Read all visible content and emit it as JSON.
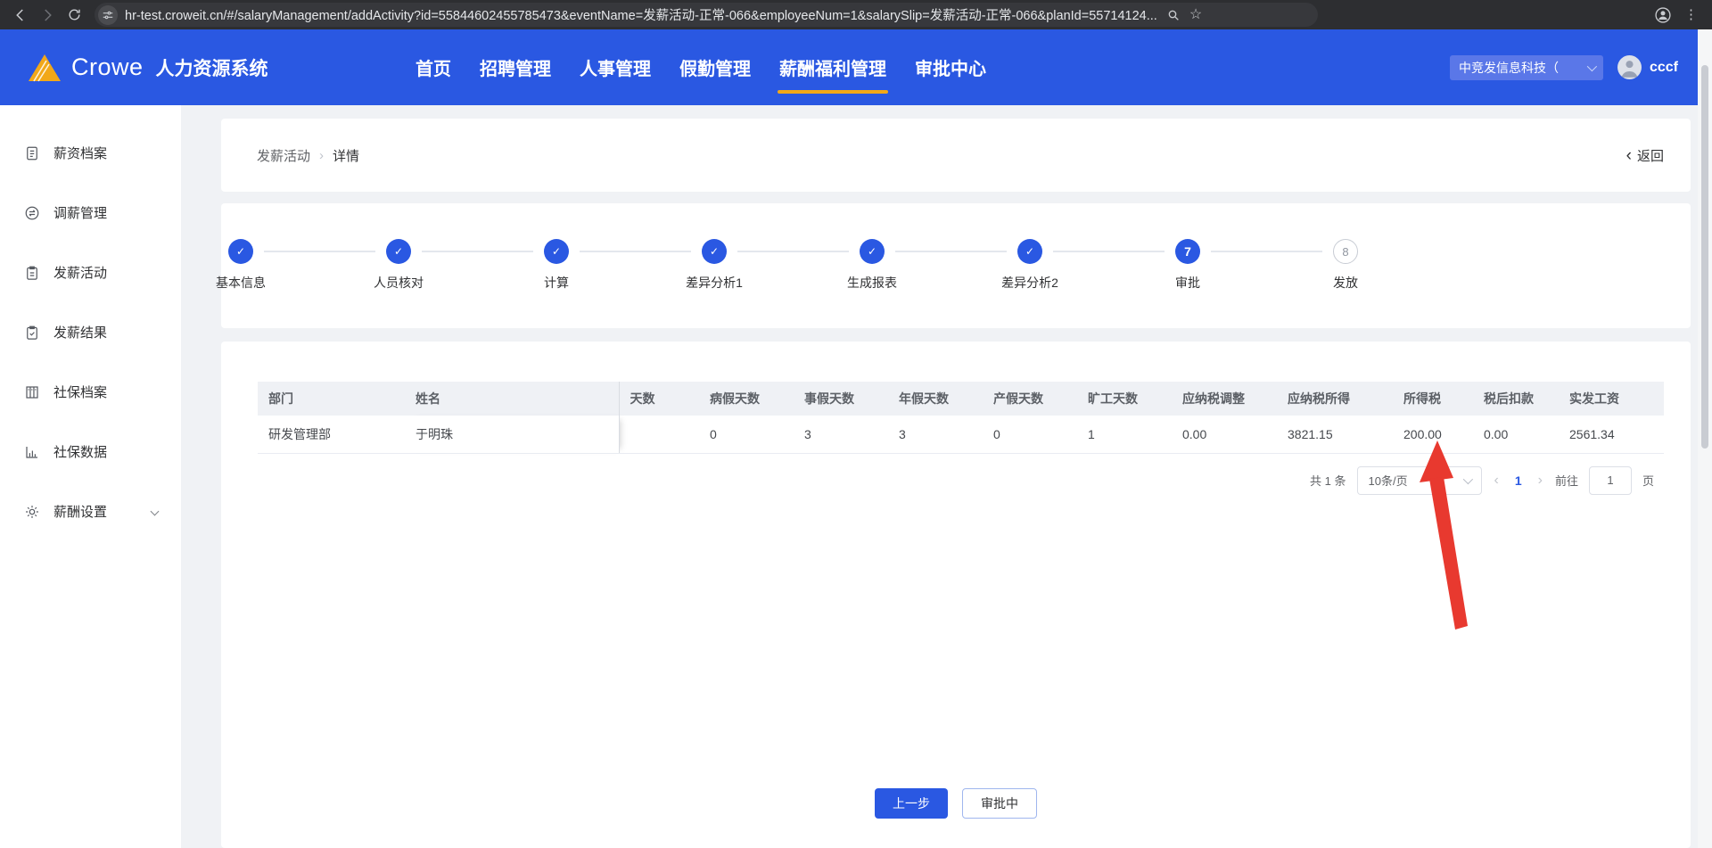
{
  "browser": {
    "url": "hr-test.croweit.cn/#/salaryManagement/addActivity?id=55844602455785473&eventName=发薪活动-正常-066&employeeNum=1&salarySlip=发薪活动-正常-066&planId=55714124...",
    "star_icon": "☆",
    "menu_icon": "⋮"
  },
  "header": {
    "brand": "Crowe",
    "app_title": "人力资源系统",
    "nav": [
      {
        "label": "首页"
      },
      {
        "label": "招聘管理"
      },
      {
        "label": "人事管理"
      },
      {
        "label": "假勤管理"
      },
      {
        "label": "薪酬福利管理"
      },
      {
        "label": "审批中心"
      }
    ],
    "company": "中竞发信息科技（",
    "username": "cccf"
  },
  "sidebar": {
    "items": [
      {
        "label": "薪资档案",
        "icon": "file-text-icon"
      },
      {
        "label": "调薪管理",
        "icon": "exchange-circle-icon"
      },
      {
        "label": "发薪活动",
        "icon": "clipboard-icon"
      },
      {
        "label": "发薪结果",
        "icon": "clipboard-check-icon"
      },
      {
        "label": "社保档案",
        "icon": "archive-icon"
      },
      {
        "label": "社保数据",
        "icon": "bar-chart-icon"
      },
      {
        "label": "薪酬设置",
        "icon": "gear-icon"
      }
    ]
  },
  "breadcrumb": {
    "section": "发薪活动",
    "separator": "›",
    "current": "详情",
    "back_arrow": "‹",
    "back_label": "返回"
  },
  "steps": [
    {
      "label": "基本信息",
      "mark": "✓",
      "state": "done"
    },
    {
      "label": "人员核对",
      "mark": "✓",
      "state": "done"
    },
    {
      "label": "计算",
      "mark": "✓",
      "state": "done"
    },
    {
      "label": "差异分析1",
      "mark": "✓",
      "state": "done"
    },
    {
      "label": "生成报表",
      "mark": "✓",
      "state": "done"
    },
    {
      "label": "差异分析2",
      "mark": "✓",
      "state": "done"
    },
    {
      "label": "审批",
      "mark": "7",
      "state": "current"
    },
    {
      "label": "发放",
      "mark": "8",
      "state": "pending"
    }
  ],
  "table": {
    "columns": [
      "部门",
      "姓名",
      "天数",
      "病假天数",
      "事假天数",
      "年假天数",
      "产假天数",
      "旷工天数",
      "应纳税调整",
      "应纳税所得",
      "所得税",
      "税后扣款",
      "实发工资"
    ],
    "rows": [
      [
        "研发管理部",
        "于明珠",
        "",
        "0",
        "3",
        "3",
        "0",
        "1",
        "0.00",
        "3821.15",
        "200.00",
        "0.00",
        "2561.34"
      ]
    ]
  },
  "pagination": {
    "total": "共 1 条",
    "page_size": "10条/页",
    "prev": "‹",
    "page": "1",
    "next": "›",
    "goto_label": "前往",
    "page_value": "1",
    "unit": "页"
  },
  "actions": {
    "prev_label": "上一步",
    "status_label": "审批中"
  },
  "annotation": {
    "shape": "red-arrow",
    "points_at": "所得税 200.00",
    "color": "#e8392f"
  },
  "colors": {
    "accent_blue": "#2a58e2",
    "brand_yellow": "#f2a819",
    "content_bg": "#f0f2f5",
    "chrome_bg": "#2d2e31"
  }
}
